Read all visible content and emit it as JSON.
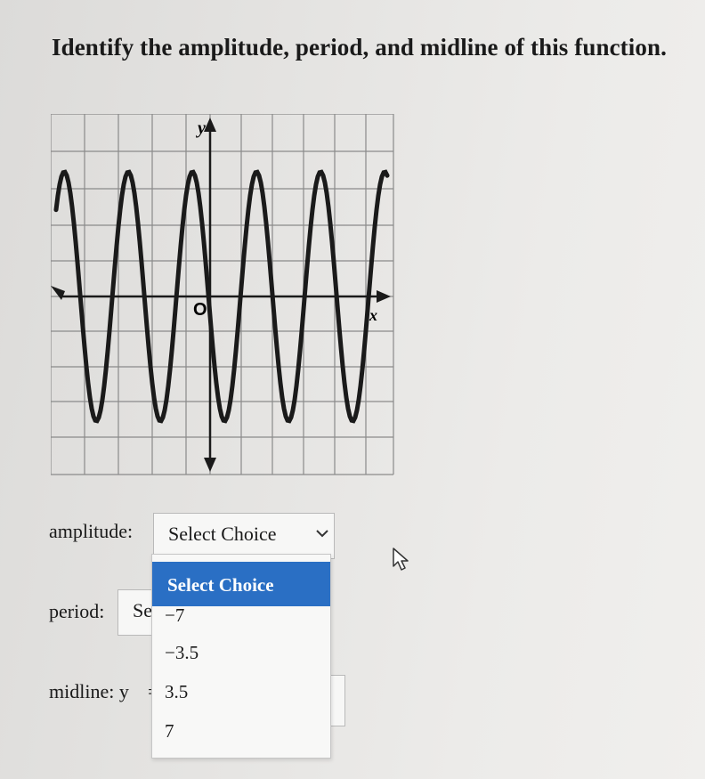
{
  "question": "Identify the amplitude, period, and midline of this function.",
  "graph": {
    "y_axis_label": "y",
    "x_axis_label": "x",
    "origin_label": "O",
    "curve": {
      "amplitude": 3.5,
      "period": 2,
      "midline": 0
    }
  },
  "amplitude": {
    "label": "amplitude:",
    "select_value": "Select Choice"
  },
  "period": {
    "label": "period:",
    "select_value": "Se"
  },
  "midline": {
    "label": "midline: y",
    "eq": "="
  },
  "dropdown": {
    "options": [
      "Select Choice",
      "−7",
      "−3.5",
      "3.5",
      "7"
    ]
  },
  "icons": {
    "amplitude_chevron": "chevron-down-icon",
    "midline_chevron": "chevron-down-icon",
    "cursor": "arrow-cursor-icon"
  },
  "colors": {
    "selected_option": "#2a6fc4",
    "grid": "#8a8a8a",
    "curve": "#1a1a1a"
  }
}
